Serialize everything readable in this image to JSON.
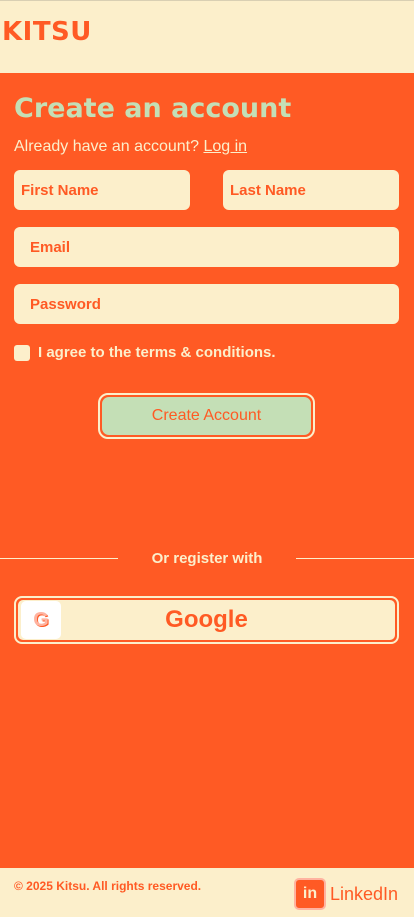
{
  "header": {
    "brand": "KITSU"
  },
  "form": {
    "title": "Create an account",
    "subtitle_text": "Already have an account?",
    "login_link": "Log in",
    "first_name_placeholder": "First Name",
    "last_name_placeholder": "Last Name",
    "email_placeholder": "Email",
    "password_placeholder": "Password",
    "terms_label": "I agree to the terms & conditions.",
    "submit_label": "Create Account"
  },
  "social": {
    "divider_label": "Or register with",
    "google_label": "Google",
    "google_icon_glyph": "G"
  },
  "footer": {
    "copyright": "© 2025 Kitsu. All rights reserved.",
    "linkedin_label": "LinkedIn",
    "linkedin_icon_glyph": "in"
  },
  "colors": {
    "primary": "#FF5A24",
    "cream": "#FCEFCB",
    "mint": "#C4DFB6"
  }
}
